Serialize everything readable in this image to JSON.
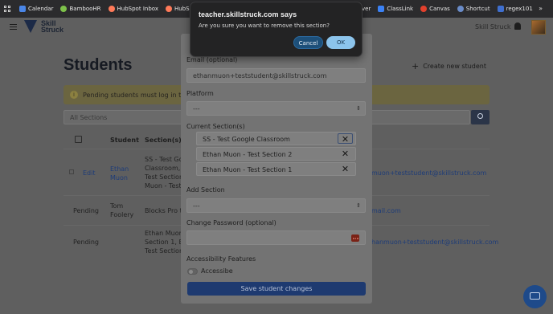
{
  "bookmarks": [
    {
      "label": "Calendar",
      "icon": "calendar-icon",
      "color": "#4a86e8"
    },
    {
      "label": "BambooHR",
      "icon": "bamboohr-icon",
      "color": "#7dc14a"
    },
    {
      "label": "HubSpot Inbox",
      "icon": "hubspot-icon",
      "color": "#ff7a59"
    },
    {
      "label": "HubSpot Tickets",
      "icon": "hubspot-icon",
      "color": "#ff7a59"
    }
  ],
  "bookmarks_right": [
    {
      "label": "ver",
      "icon": "",
      "color": ""
    },
    {
      "label": "ClassLink",
      "icon": "classlink-icon",
      "color": "#3b82f6"
    },
    {
      "label": "Canvas",
      "icon": "canvas-icon",
      "color": "#e2402c"
    },
    {
      "label": "Shortcut",
      "icon": "shortcut-icon",
      "color": "#6a8cc9"
    },
    {
      "label": "regex101",
      "icon": "regex101-icon",
      "color": "#3f6fcf"
    }
  ],
  "header": {
    "logo_line1": "Skill",
    "logo_line2": "Struck",
    "user_name": "Skill Struck"
  },
  "page": {
    "title": "Students",
    "create_button": "Create new student",
    "alert_text": "Pending students must log in to th",
    "filter_value": "All Sections",
    "table_headers": {
      "student": "Student",
      "sections": "Section(s)"
    },
    "rows": [
      {
        "action": "Edit",
        "name_line1": "Ethan",
        "name_line2": "Muon",
        "sections": [
          "SS - Test Go",
          "Classroom, E",
          "Test Section",
          "Muon - Test"
        ],
        "email": "muon+teststudent@skillstruck.com"
      },
      {
        "action": "Pending",
        "name_line1": "Tom",
        "name_line2": "Foolery",
        "sections": [
          "Blocks Pro te"
        ],
        "email": "mail.com"
      },
      {
        "action": "Pending",
        "name_line1": "",
        "name_line2": "",
        "sections": [
          "Ethan Muon",
          "Section 1, Et",
          "Test Section"
        ],
        "email": "hanmuon+teststudent@skillstruck.com"
      }
    ]
  },
  "modal": {
    "email_label": "Email (optional)",
    "email_value": "ethanmuon+teststudent@skillstruck.com",
    "platform_label": "Platform",
    "platform_value": "---",
    "current_sections_label": "Current Section(s)",
    "sections": [
      "SS - Test Google Classroom",
      "Ethan Muon - Test Section 2",
      "Ethan Muon - Test Section 1"
    ],
    "add_section_label": "Add Section",
    "add_section_value": "---",
    "password_label": "Change Password (optional)",
    "password_value": "",
    "accessibility_label": "Accessibility Features",
    "accessible_toggle_label": "Accessibe",
    "accessible_on": false,
    "save_button": "Save student changes"
  },
  "dialog": {
    "title": "teacher.skillstruck.com says",
    "message": "Are you sure you want to remove this section?",
    "cancel_label": "Cancel",
    "ok_label": "OK"
  }
}
